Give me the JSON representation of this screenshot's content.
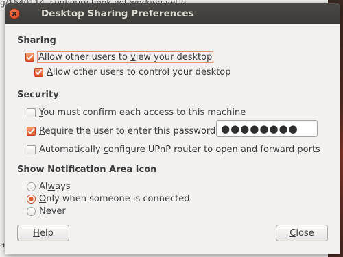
{
  "background": {
    "top_text": "g/1640114, configure hook not working yet o...",
    "bottom_text": "a"
  },
  "window": {
    "title": "Desktop Sharing Preferences"
  },
  "sharing": {
    "header": "Sharing",
    "view_desktop": {
      "prefix": "Allow other users to ",
      "mnemonic": "v",
      "suffix": "iew your desktop",
      "checked": true
    },
    "control_desktop": {
      "prefix": "",
      "mnemonic": "A",
      "suffix": "llow other users to control your desktop",
      "checked": true
    }
  },
  "security": {
    "header": "Security",
    "confirm_access": {
      "prefix": "",
      "mnemonic": "Y",
      "suffix": "ou must confirm each access to this machine",
      "checked": false
    },
    "require_password": {
      "prefix": "",
      "mnemonic": "R",
      "suffix": "equire the user to enter this password:",
      "checked": true
    },
    "password_value": "●●●●●●●●",
    "upnp": {
      "prefix": "Automatically ",
      "mnemonic": "c",
      "suffix": "onfigure UPnP router to open and forward ports",
      "checked": false
    }
  },
  "notification": {
    "header": "Show Notification Area Icon",
    "always": {
      "prefix": "Al",
      "mnemonic": "w",
      "suffix": "ays",
      "selected": false
    },
    "only_connected": {
      "prefix": "",
      "mnemonic": "O",
      "suffix": "nly when someone is connected",
      "selected": true
    },
    "never": {
      "prefix": "",
      "mnemonic": "N",
      "suffix": "ever",
      "selected": false
    }
  },
  "buttons": {
    "help": {
      "prefix": "",
      "mnemonic": "H",
      "suffix": "elp"
    },
    "close": {
      "prefix": "",
      "mnemonic": "C",
      "suffix": "lose"
    }
  },
  "colors": {
    "accent": "#e05a2a",
    "titlebar": "#3c3b37"
  }
}
